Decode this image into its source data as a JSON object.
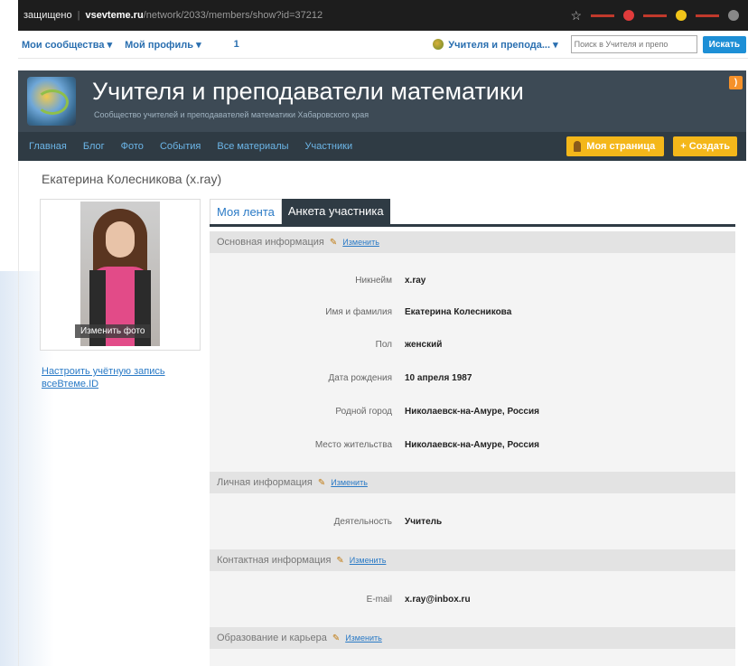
{
  "browser": {
    "security": "защищено",
    "host": "vsevteme.ru",
    "path": "/network/2033/members/show?id=37212"
  },
  "topnav": {
    "my_communities": "Мои сообщества ▾",
    "my_profile": "Мой профиль ▾",
    "count": "1",
    "community": "Учителя и препода... ▾",
    "search_placeholder": "Поиск в Учителя и препо",
    "search_button": "Искать"
  },
  "header": {
    "title": "Учителя и преподаватели математики",
    "subtitle": "Сообщество учителей и преподавателей математики Хабаровского края"
  },
  "subnav": {
    "items": [
      "Главная",
      "Блог",
      "Фото",
      "События",
      "Все материалы",
      "Участники"
    ],
    "my_page": "Моя страница",
    "create": "+ Создать"
  },
  "profile": {
    "name_title": "Екатерина Колесникова (x.ray)",
    "change_photo": "Изменить фото",
    "account_link": "Настроить учётную запись всеВтеме.ID"
  },
  "tabs": {
    "feed": "Моя лента",
    "questionnaire": "Анкета участника"
  },
  "sections": {
    "basic": "Основная информация",
    "personal": "Личная информация",
    "contact": "Контактная информация",
    "education": "Образование и карьера",
    "edit": "Изменить"
  },
  "fields": {
    "nickname_label": "Никнейм",
    "nickname": "x.ray",
    "fullname_label": "Имя и фамилия",
    "fullname": "Екатерина Колесникова",
    "gender_label": "Пол",
    "gender": "женский",
    "birth_label": "Дата рождения",
    "birth": "10 апреля 1987",
    "hometown_label": "Родной город",
    "hometown": "Николаевск-на-Амуре, Россия",
    "residence_label": "Место жительства",
    "residence": "Николаевск-на-Амуре, Россия",
    "activity_label": "Деятельность",
    "activity": "Учитель",
    "email_label": "E-mail",
    "email": "x.ray@inbox.ru"
  },
  "colors": {
    "header_bg": "#3d4a55",
    "subnav_bg": "#2f3b44",
    "accent": "#f4b71a",
    "link": "#2a7ac6"
  }
}
